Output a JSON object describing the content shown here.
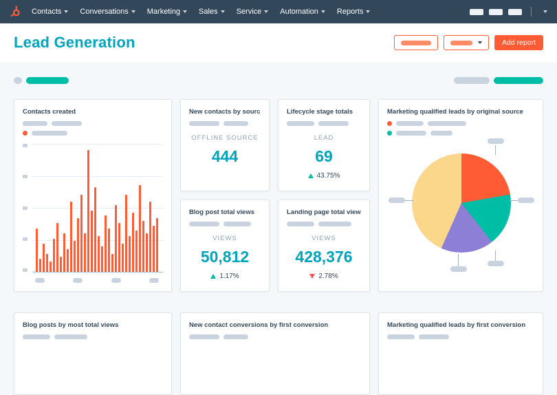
{
  "nav": {
    "items": [
      {
        "label": "Contacts"
      },
      {
        "label": "Conversations"
      },
      {
        "label": "Marketing"
      },
      {
        "label": "Sales"
      },
      {
        "label": "Service"
      },
      {
        "label": "Automation"
      },
      {
        "label": "Reports"
      }
    ]
  },
  "header": {
    "title": "Lead Generation",
    "add_report_label": "Add report"
  },
  "colors": {
    "nav_navy": "#33475b",
    "accent_teal": "#00a4bd",
    "accent_teal_bright": "#00bda5",
    "accent_orange": "#ff5c35",
    "positive": "#00bda5",
    "negative": "#f2545b",
    "placeholder_gray": "#c9d3e0"
  },
  "icons": {
    "logo": "hubspot-sprocket",
    "nav_caret": "chevron-down"
  },
  "cards": {
    "contacts_created": {
      "title": "Contacts created",
      "chart_data": {
        "type": "bar",
        "unit": "percent-of-max",
        "color": "#ff5c35",
        "values": [
          34,
          10,
          22,
          14,
          8,
          26,
          38,
          12,
          30,
          18,
          55,
          24,
          42,
          60,
          30,
          95,
          48,
          66,
          28,
          20,
          44,
          34,
          14,
          52,
          38,
          22,
          60,
          28,
          46,
          32,
          68,
          40,
          30,
          55,
          36,
          42
        ]
      }
    },
    "new_contacts_by_source": {
      "title": "New contacts by source",
      "metric_label": "OFFLINE SOURCE",
      "metric_value": "444"
    },
    "lifecycle_stage_totals": {
      "title": "Lifecycle stage totals",
      "metric_label": "LEAD",
      "metric_value": "69",
      "delta": "43.75%",
      "delta_direction": "up"
    },
    "mql_by_original_source": {
      "title": "Marketing qualified leads by original source",
      "chart_data": {
        "type": "pie",
        "slices": [
          {
            "name": "slice-orange",
            "degrees": 80,
            "color": "#ff5c35"
          },
          {
            "name": "slice-teal",
            "degrees": 62,
            "color": "#00bda5"
          },
          {
            "name": "slice-purple",
            "degrees": 62,
            "color": "#8d7fd6"
          },
          {
            "name": "slice-yellow",
            "degrees": 156,
            "color": "#fbd78c"
          }
        ]
      }
    },
    "blog_post_total_views": {
      "title": "Blog post total views",
      "metric_label": "VIEWS",
      "metric_value": "50,812",
      "delta": "1.17%",
      "delta_direction": "up"
    },
    "landing_page_total_views": {
      "title": "Landing page total views",
      "metric_label": "VIEWS",
      "metric_value": "428,376",
      "delta": "2.78%",
      "delta_direction": "down"
    },
    "blog_posts_by_most_total_views": {
      "title": "Blog posts by most total views"
    },
    "new_contact_conversions_by_first_conversion": {
      "title": "New contact conversions by first conversion"
    },
    "mql_by_first_conversion": {
      "title": "Marketing qualified leads by first conversion"
    }
  }
}
